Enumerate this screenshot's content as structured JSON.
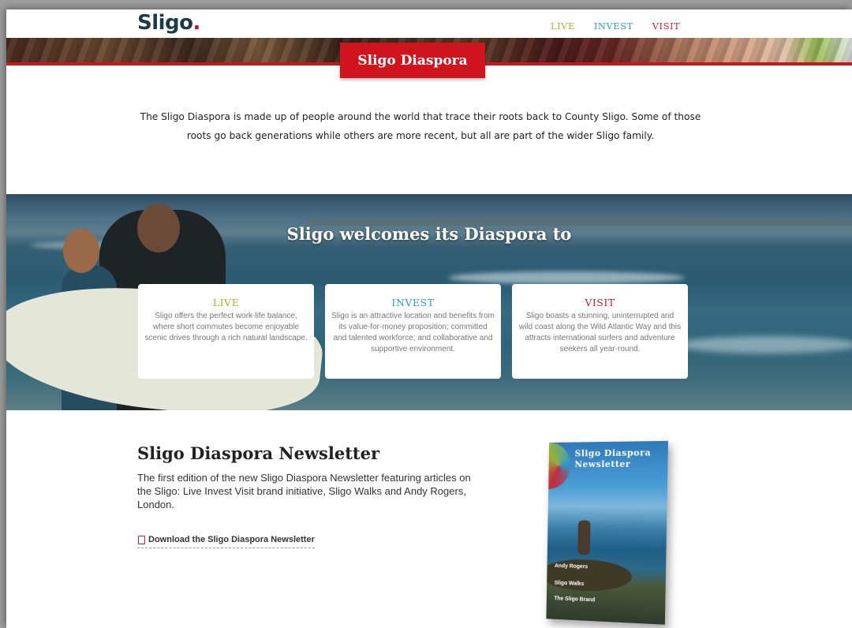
{
  "header": {
    "logo": "Sligo",
    "logo_dot": ".",
    "nav": [
      {
        "label": "LIVE",
        "color": "#a3b72b"
      },
      {
        "label": "INVEST",
        "color": "#2a9bd3"
      },
      {
        "label": "VISIT",
        "color": "#d0202e"
      }
    ]
  },
  "page": {
    "title": "Sligo Diaspora",
    "intro": "The Sligo Diaspora is made up of people around the world that trace their roots back to County Sligo. Some of those roots go back generations while others are more recent, but all are part of the wider Sligo family."
  },
  "hero": {
    "title": "Sligo welcomes its Diaspora to",
    "cards": [
      {
        "title": "LIVE",
        "text": "Sligo offers the perfect work-life balance, where short commutes become enjoyable scenic drives through a rich natural landscape."
      },
      {
        "title": "INVEST",
        "text": "Sligo is an attractive location and benefits from its value-for-money proposition; committed and talented workforce; and collaborative and supportive environment."
      },
      {
        "title": "VISIT",
        "text": "Sligo boasts a stunning, uninterrupted and wild coast along the Wild Atlantic Way and this attracts international surfers and adventure seekers all year-round."
      }
    ]
  },
  "newsletter": {
    "title": "Sligo Diaspora Newsletter",
    "description": "The first edition of the new Sligo Diaspora Newsletter featuring articles on the Sligo: Live Invest Visit brand initiative, Sligo Walks and Andy Rogers, London.",
    "link": "Download the Sligo Diaspora Newsletter",
    "cover": {
      "title_line1": "Sligo Diaspora",
      "title_line2": "Newsletter",
      "items": [
        "Andy Rogers",
        "Sligo Walks",
        "The Sligo Brand"
      ]
    }
  },
  "colors": {
    "brand_red": "#d0141e",
    "live": "#a3b72b",
    "invest": "#2a9bd3",
    "visit": "#d0202e"
  }
}
